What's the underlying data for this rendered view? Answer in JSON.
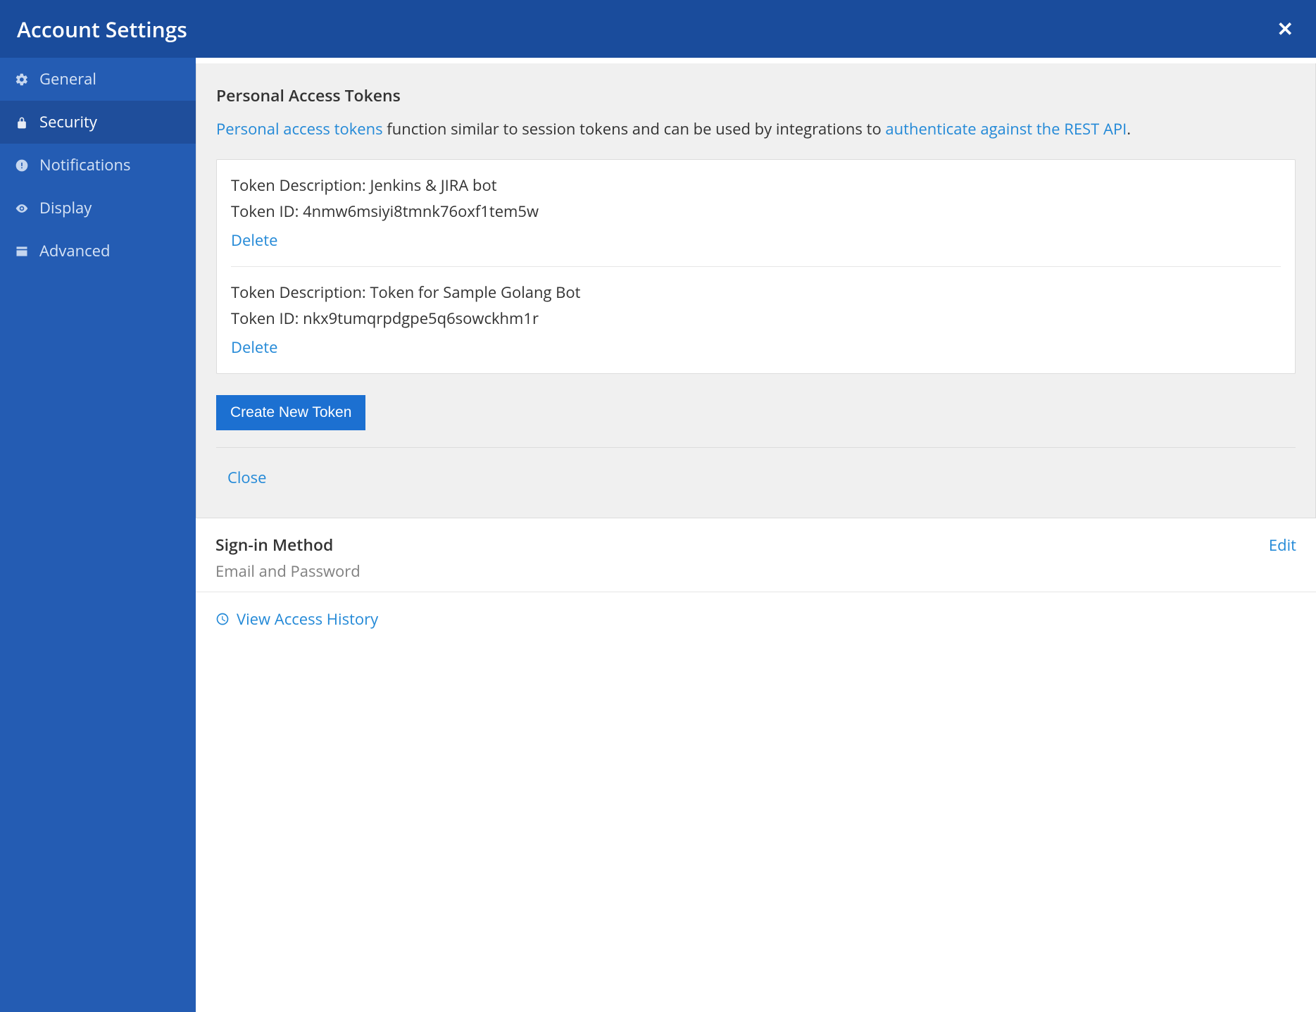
{
  "header": {
    "title": "Account Settings"
  },
  "sidebar": {
    "items": [
      {
        "label": "General",
        "icon": "gear-icon"
      },
      {
        "label": "Security",
        "icon": "lock-icon"
      },
      {
        "label": "Notifications",
        "icon": "exclamation-circle-icon"
      },
      {
        "label": "Display",
        "icon": "eye-icon"
      },
      {
        "label": "Advanced",
        "icon": "layout-icon"
      }
    ],
    "active_index": 1
  },
  "tokens_section": {
    "title": "Personal Access Tokens",
    "desc_link1": "Personal access tokens",
    "desc_mid": " function similar to session tokens and can be used by integrations to ",
    "desc_link2": "authenticate against the REST API",
    "desc_tail": ".",
    "token_desc_label": "Token Description: ",
    "token_id_label": "Token ID: ",
    "delete_label": "Delete",
    "tokens": [
      {
        "description": "Jenkins & JIRA bot",
        "id": "4nmw6msiyi8tmnk76oxf1tem5w"
      },
      {
        "description": "Token for Sample Golang Bot",
        "id": "nkx9tumqrpdgpe5q6sowckhm1r"
      }
    ],
    "create_button": "Create New Token",
    "close_label": "Close"
  },
  "signin": {
    "title": "Sign-in Method",
    "value": "Email and Password",
    "edit_label": "Edit"
  },
  "access_history": {
    "label": "View Access History"
  }
}
